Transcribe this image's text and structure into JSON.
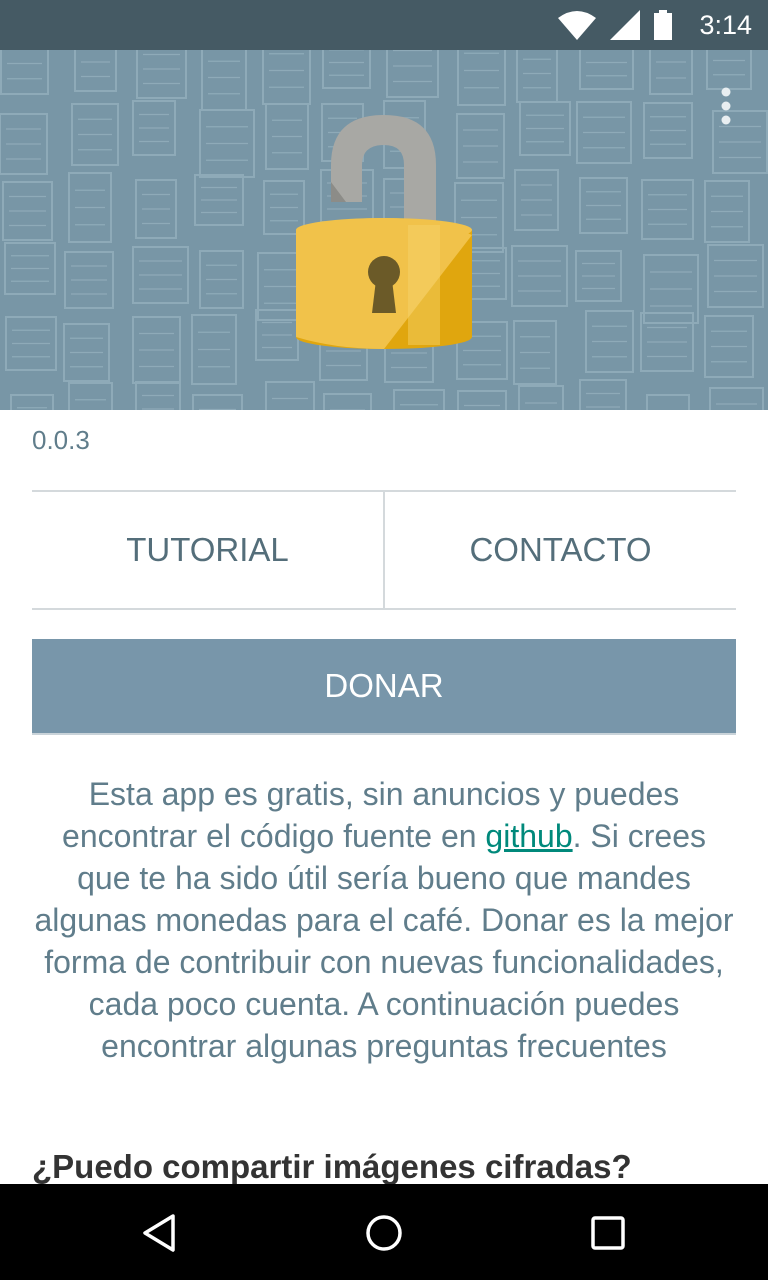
{
  "status_bar": {
    "time": "3:14",
    "icons": [
      "wifi-icon",
      "signal-icon",
      "battery-icon"
    ]
  },
  "hero": {
    "image": "padlock-open-icon",
    "menu_icon": "more-vert-icon"
  },
  "version": "0.0.3",
  "tabs": [
    {
      "label": "TUTORIAL"
    },
    {
      "label": "CONTACTO"
    }
  ],
  "donate_label": "DONAR",
  "info": {
    "before_link": "Esta app es gratis, sin anuncios y puedes encontrar el código fuente en ",
    "link": "github",
    "after_link": ". Si crees que te ha sido útil sería bueno que mandes algunas monedas para el café. Donar es la mejor forma de contribuir con nuevas funcionalidades, cada poco cuenta. A continuación puedes encontrar algunas preguntas frecuentes"
  },
  "faq_question": "¿Puedo compartir imágenes cifradas?",
  "colors": {
    "primary": "#7896aa",
    "status_bar": "#455a64",
    "link": "#00897b",
    "lock_gold": "#f1c24a"
  },
  "nav": [
    "back-icon",
    "home-icon",
    "recents-icon"
  ]
}
